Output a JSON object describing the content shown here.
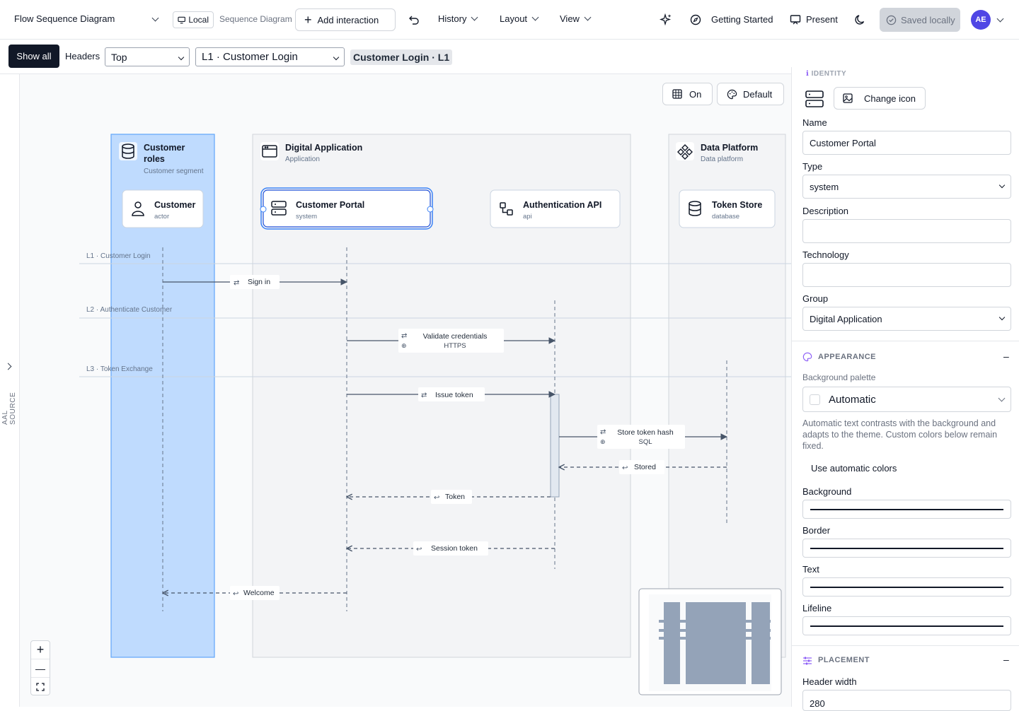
{
  "app": {
    "title": "Flow Sequence Diagram",
    "mode": "Local",
    "diagram_type": "Sequence Diagram"
  },
  "header": {
    "add_interaction": "Add interaction",
    "menus": [
      "History",
      "Layout",
      "View"
    ],
    "getting_started": "Getting Started",
    "present": "Present",
    "saved": "Saved locally",
    "avatar": "AE"
  },
  "toolbar": {
    "show_all": "Show all",
    "headers_label": "Headers",
    "headers_value": "Top",
    "level_value": "L1 · Customer Login",
    "crumb": "Customer Login · L1"
  },
  "canvas_controls": {
    "grid": "On",
    "theme": "Default",
    "side_tab": "AAL SOURCE"
  },
  "groups": [
    {
      "title": "Customer roles",
      "subtitle": "Customer segment",
      "title_line1": "Customer",
      "title_line2": "roles"
    },
    {
      "title": "Digital Application",
      "subtitle": "Application"
    },
    {
      "title": "Data Platform",
      "subtitle": "Data platform"
    }
  ],
  "participants": [
    {
      "name": "Customer",
      "type": "actor"
    },
    {
      "name": "Customer Portal",
      "type": "system"
    },
    {
      "name": "Authentication API",
      "type": "api"
    },
    {
      "name": "Token Store",
      "type": "database"
    }
  ],
  "levels": [
    "L1 · Customer Login",
    "L2 · Authenticate Customer",
    "L3 · Token Exchange"
  ],
  "messages": [
    {
      "label": "Sign in"
    },
    {
      "label": "Validate credentials",
      "tech": "HTTPS"
    },
    {
      "label": "Issue token"
    },
    {
      "label": "Store token hash",
      "tech": "SQL"
    },
    {
      "label": "Stored"
    },
    {
      "label": "Token"
    },
    {
      "label": "Session token"
    },
    {
      "label": "Welcome"
    }
  ],
  "panel": {
    "identity_label": "IDENTITY",
    "change_icon": "Change icon",
    "name_label": "Name",
    "name_value": "Customer Portal",
    "type_label": "Type",
    "type_value": "system",
    "description_label": "Description",
    "description_value": "",
    "technology_label": "Technology",
    "technology_value": "",
    "group_label": "Group",
    "group_value": "Digital Application",
    "appearance": "APPEARANCE",
    "bg_palette_label": "Background palette",
    "bg_palette_value": "Automatic",
    "palette_help": "Automatic text contrasts with the background and adapts to the theme. Custom colors below remain fixed.",
    "use_auto": "Use automatic colors",
    "background": "Background",
    "border": "Border",
    "text": "Text",
    "lifeline": "Lifeline",
    "placement": "PLACEMENT",
    "header_width_label": "Header width",
    "header_width_value": "280",
    "collapse": "–"
  },
  "colors": {
    "accent": "#2563eb",
    "selection_fill": "#bfdbfe",
    "line": "#475569",
    "group_fill": "#f3f4f6"
  }
}
